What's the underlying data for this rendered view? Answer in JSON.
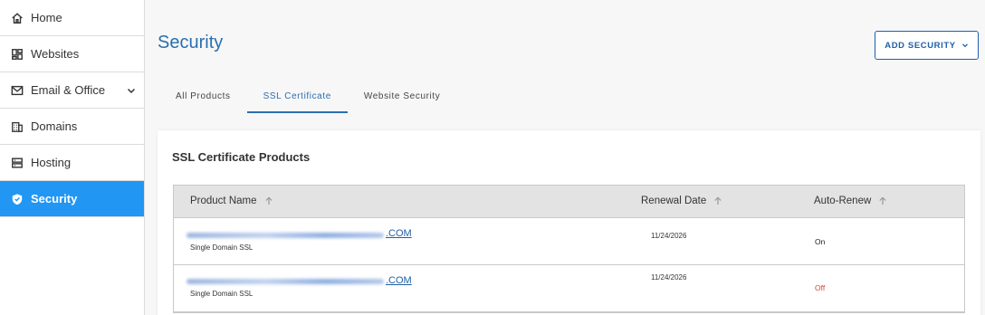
{
  "sidebar": {
    "items": [
      {
        "label": "Home"
      },
      {
        "label": "Websites"
      },
      {
        "label": "Email & Office"
      },
      {
        "label": "Domains"
      },
      {
        "label": "Hosting"
      },
      {
        "label": "Security"
      }
    ]
  },
  "page": {
    "title": "Security",
    "add_button": "ADD SECURITY"
  },
  "tabs": [
    {
      "label": "All Products"
    },
    {
      "label": "SSL Certificate"
    },
    {
      "label": "Website Security"
    }
  ],
  "card": {
    "title": "SSL Certificate Products"
  },
  "table": {
    "columns": [
      "Product Name",
      "Renewal Date",
      "Auto-Renew"
    ],
    "rows": [
      {
        "domain_suffix": ".COM",
        "product_type": "Single Domain SSL",
        "renewal_date": "11/24/2026",
        "auto_renew": "On"
      },
      {
        "domain_suffix": ".COM",
        "product_type": "Single Domain SSL",
        "renewal_date": "11/24/2026",
        "auto_renew": "Off"
      }
    ]
  },
  "colors": {
    "accent": "#2196f3",
    "link": "#1f5fa8",
    "off_status": "#d9453a"
  }
}
